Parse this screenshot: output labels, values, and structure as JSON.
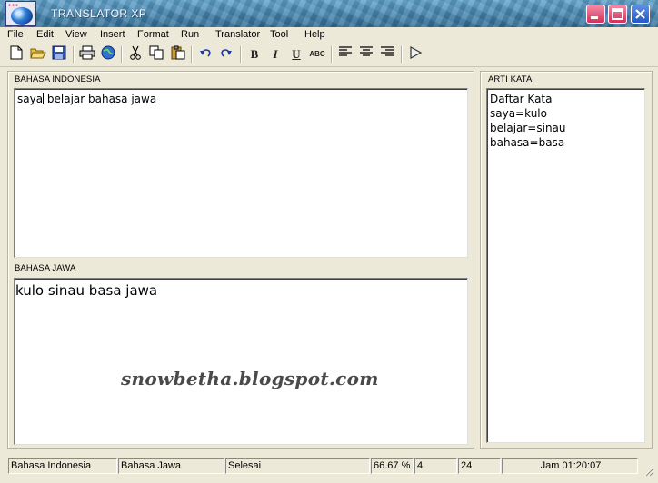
{
  "window": {
    "title": "TRANSLATOR XP"
  },
  "menu": [
    "File",
    "Edit",
    "View",
    "Insert",
    "Format",
    "Run",
    "Translator",
    "Tool",
    "Help"
  ],
  "source": {
    "label": "BAHASA INDONESIA",
    "text_before_caret": "saya",
    "text_after_caret": " belajar bahasa jawa"
  },
  "target": {
    "label": "BAHASA JAWA",
    "text": "kulo sinau basa jawa"
  },
  "dictionary": {
    "label": "ARTI KATA",
    "lines": [
      "Daftar Kata",
      "saya=kulo",
      "belajar=sinau",
      "bahasa=basa"
    ]
  },
  "watermark": "snowbetha.blogspot.com",
  "status": {
    "source_lang": "Bahasa Indonesia",
    "target_lang": "Bahasa Jawa",
    "state": "Selesai",
    "percent": "66.67 %",
    "count_a": "4",
    "count_b": "24",
    "clock": "Jam 01:20:07"
  }
}
